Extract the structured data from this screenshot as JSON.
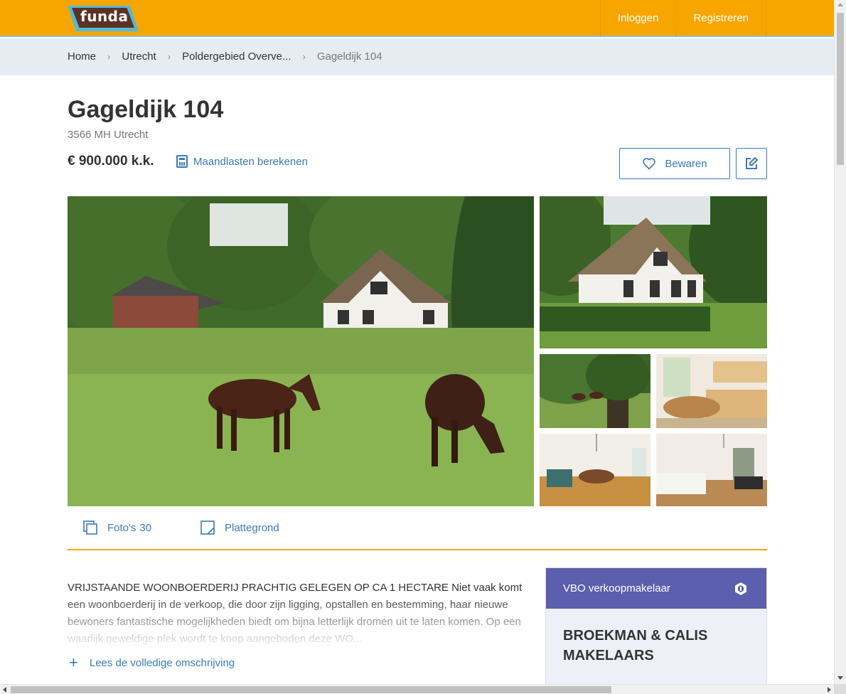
{
  "brand": {
    "logo_text": "funda",
    "accent": "#f7a600",
    "link_color": "#3a7bb8"
  },
  "nav": {
    "login": "Inloggen",
    "register": "Registreren"
  },
  "breadcrumb": {
    "items": [
      "Home",
      "Utrecht",
      "Poldergebied Overve..."
    ],
    "current": "Gageldijk 104"
  },
  "listing": {
    "title": "Gageldijk 104",
    "address": "3566 MH Utrecht",
    "price": "€ 900.000 k.k.",
    "calc_link": "Maandlasten berekenen",
    "save_label": "Bewaren"
  },
  "photos": {
    "main": "Farmhouse with thatched roof and two horses grazing in meadow",
    "thumbs": [
      "House front view",
      "Horses under tree",
      "Kitchen with table",
      "Living room",
      "Bedroom"
    ]
  },
  "media_tabs": {
    "photos_label": "Foto's",
    "photos_count": "30",
    "floorplan_label": "Plattegrond"
  },
  "description": {
    "text": "VRIJSTAANDE WOONBOERDERIJ PRACHTIG GELEGEN OP CA 1 HECTARE Niet vaak komt een woonboerderij in de verkoop, die door zijn ligging, opstallen en bestemming, haar nieuwe bewoners fantastische mogelijkheden biedt om bijna letterlijk dromen uit te laten komen. Op een waarlijk geweldige plek wordt te koop aangeboden deze WO...",
    "read_more": "Lees de volledige omschrijving"
  },
  "agent": {
    "header": "VBO verkoopmakelaar",
    "name": "BROEKMAN & CALIS MAKELAARS",
    "header_color": "#5b5fad"
  }
}
